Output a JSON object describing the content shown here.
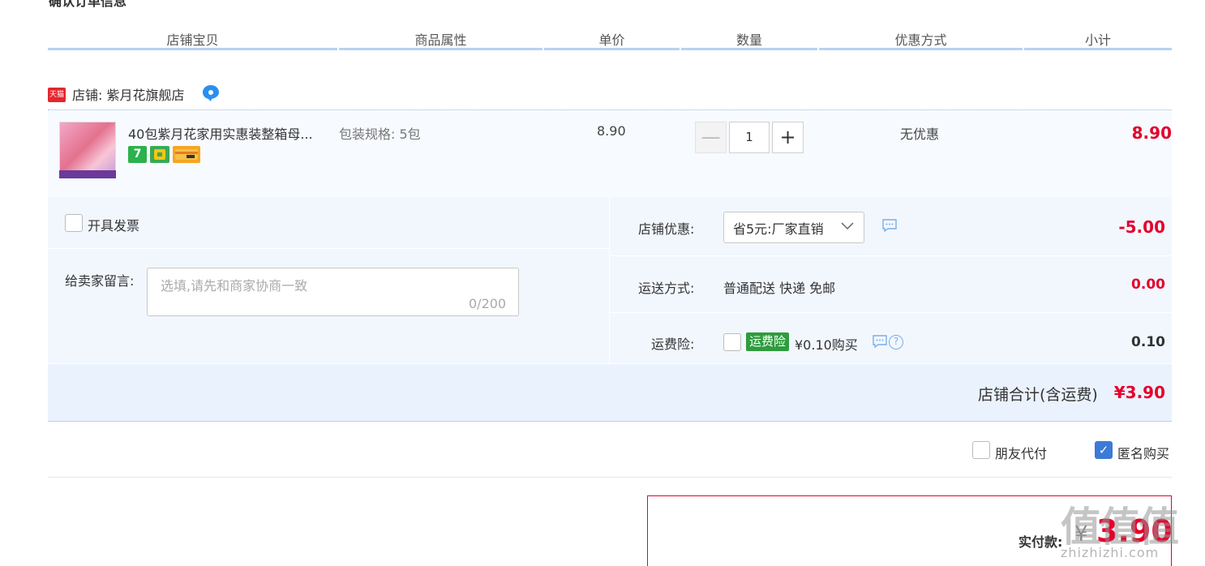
{
  "page": {
    "cut_title": "确认订单信息"
  },
  "columns": [
    "店铺宝贝",
    "商品属性",
    "单价",
    "数量",
    "优惠方式",
    "小计"
  ],
  "shop": {
    "label": "店铺: 紫月花旗舰店",
    "badge": "天猫"
  },
  "item": {
    "title": "40包紫月花家用实惠装整箱母...",
    "attribute": "包装规格: 5包",
    "unit_price": "8.90",
    "quantity": "1",
    "minus": "—",
    "plus": "+",
    "promo": "无优惠",
    "subtotal": "8.90",
    "badges": [
      "7",
      "",
      ""
    ]
  },
  "options": {
    "invoice_label": "开具发票",
    "message_label": "给卖家留言:",
    "message_placeholder": "选填,请先和商家协商一致",
    "message_count": "0/200",
    "shop_discount_label": "店铺优惠:",
    "shop_discount_value": "省5元:厂家直销",
    "shop_discount_amount": "-5.00",
    "shipping_label": "运送方式:",
    "shipping_value": "普通配送 快递 免邮",
    "shipping_amount": "0.00",
    "insurance_label": "运费险:",
    "insurance_tag": "运费险",
    "insurance_price": "¥0.10购买",
    "insurance_amount": "0.10"
  },
  "totals": {
    "label": "店铺合计(含运费)",
    "value": "¥3.90"
  },
  "extra": {
    "friend_pay": "朋友代付",
    "anonymous": "匿名购买",
    "anonymous_checked": true
  },
  "payment": {
    "label": "实付款:",
    "currency": "¥",
    "amount": "3.90"
  },
  "watermark": {
    "text": "值值值",
    "url": "zhizhizhi.com"
  },
  "colors": {
    "accent_red": "#e4002b",
    "header_line": "#b7d2f2",
    "panel_bg": "#f2f7fe",
    "tmall_red": "#e3262f",
    "checkbox_blue": "#3c7ad6"
  }
}
